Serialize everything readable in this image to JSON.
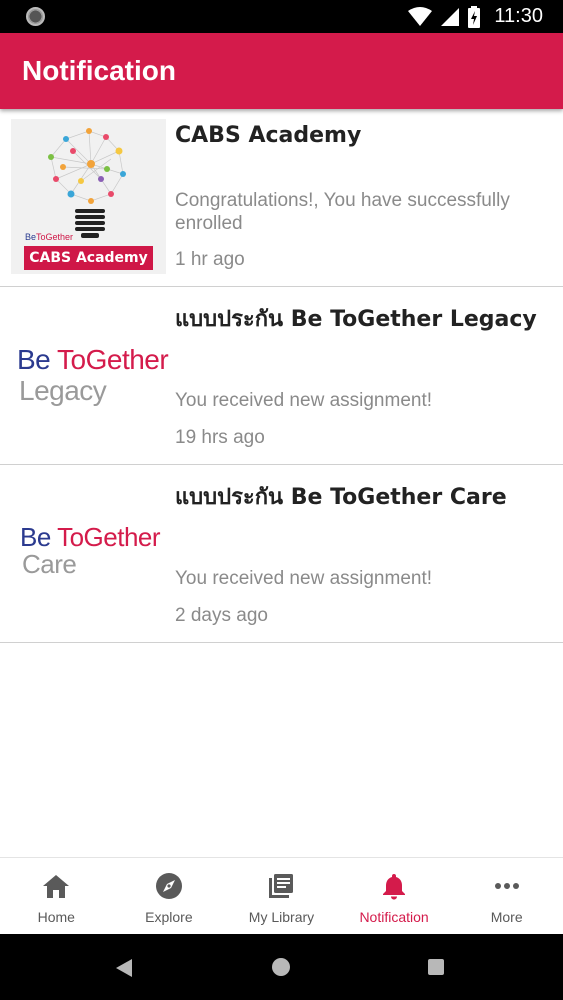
{
  "status_bar": {
    "time": "11:30"
  },
  "app_bar": {
    "title": "Notification"
  },
  "notifications": [
    {
      "title": "CABS Academy",
      "message": "Congratulations!, You have successfully enrolled",
      "time": "1 hr ago",
      "thumbnail": {
        "brand_be": "Be",
        "brand_tg": "ToGether",
        "badge": "CABS Academy"
      }
    },
    {
      "title": "แบบประกัน Be ToGether Legacy",
      "message": "You received new assignment!",
      "time": "19 hrs ago",
      "thumbnail": {
        "be": "Be",
        "together": "ToGether",
        "product": "Legacy"
      }
    },
    {
      "title": "แบบประกัน Be ToGether Care",
      "message": "You received new assignment!",
      "time": "2 days ago",
      "thumbnail": {
        "be": "Be",
        "together": "ToGether",
        "product": "Care"
      }
    }
  ],
  "bottom_nav": {
    "items": [
      {
        "label": "Home",
        "icon": "home-icon"
      },
      {
        "label": "Explore",
        "icon": "compass-icon"
      },
      {
        "label": "My Library",
        "icon": "library-icon"
      },
      {
        "label": "Notification",
        "icon": "bell-icon",
        "active": true
      },
      {
        "label": "More",
        "icon": "more-icon"
      }
    ]
  },
  "colors": {
    "brand": "#d41b4b",
    "navy": "#2b3a8f",
    "muted_text": "#8a8a8a"
  }
}
